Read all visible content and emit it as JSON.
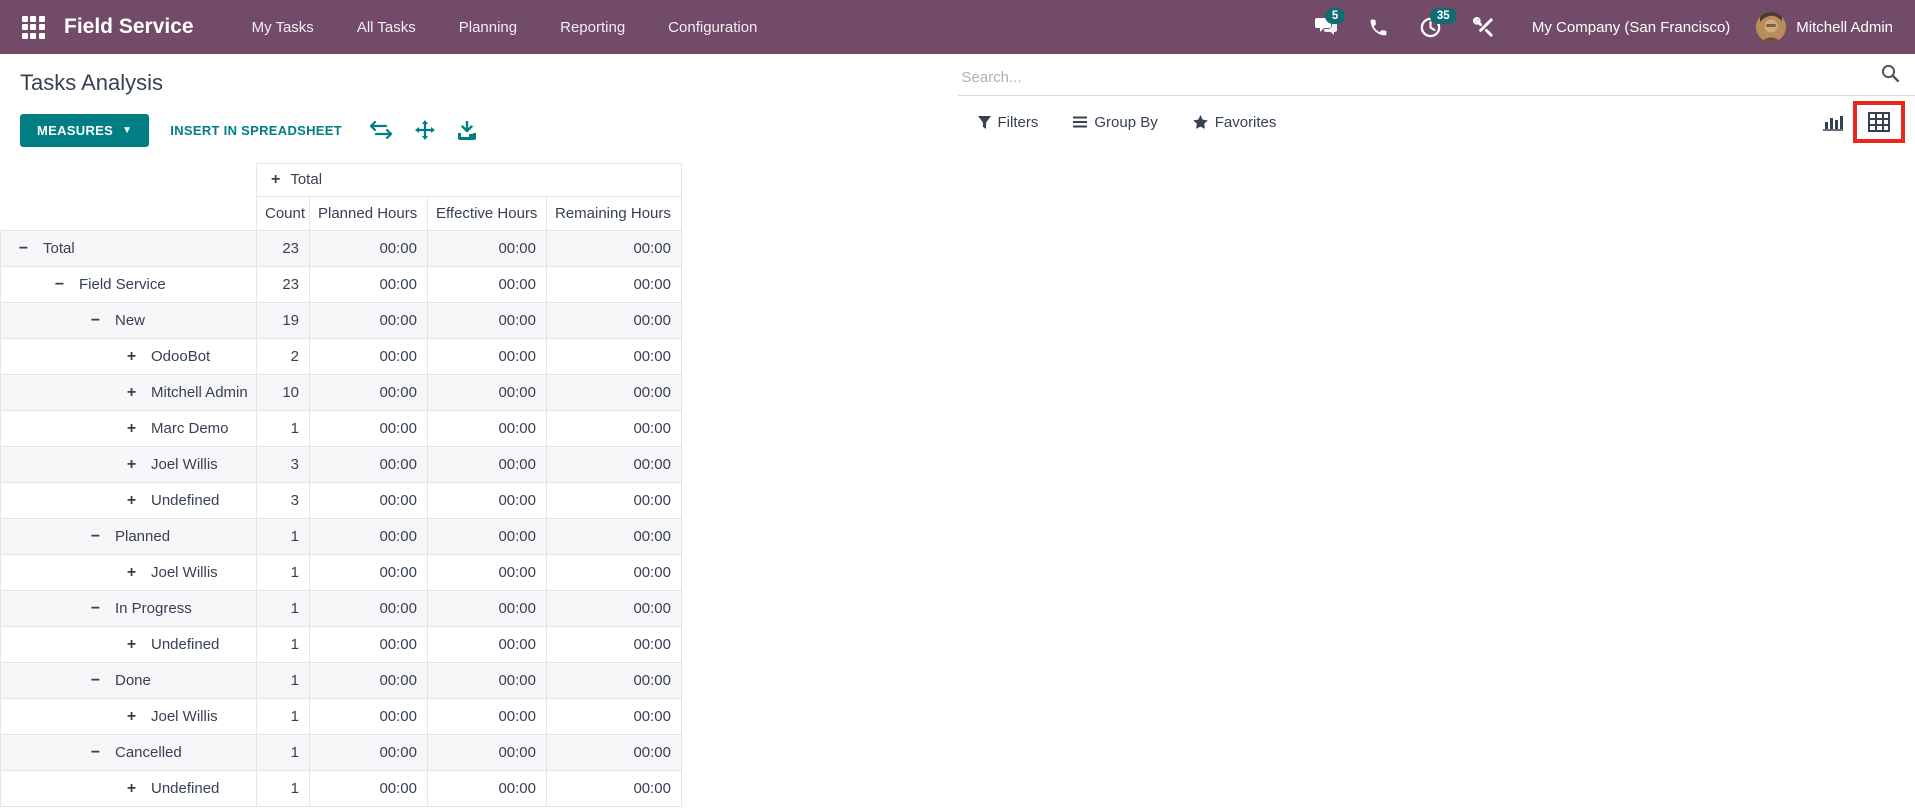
{
  "navbar": {
    "brand": "Field Service",
    "items": [
      "My Tasks",
      "All Tasks",
      "Planning",
      "Reporting",
      "Configuration"
    ],
    "systray": {
      "messages_badge": "5",
      "activities_badge": "35",
      "company": "My Company (San Francisco)",
      "user": "Mitchell Admin"
    }
  },
  "control_panel": {
    "title": "Tasks Analysis",
    "search_placeholder": "Search..."
  },
  "toolbar": {
    "measures_label": "MEASURES",
    "insert_label": "INSERT IN SPREADSHEET",
    "filters_label": "Filters",
    "group_by_label": "Group By",
    "favorites_label": "Favorites"
  },
  "colors": {
    "navbar_bg": "#714B67",
    "accent_teal": "#017E84",
    "badge_teal": "#0E6C72",
    "highlight_red": "#E8271F",
    "row_stripe": "#F7F7F9",
    "text_dark": "#374151"
  },
  "icons": {
    "apps": "grid-icon",
    "messages": "chat-bubbles-icon",
    "calls": "phone-icon",
    "activities": "clock-icon",
    "tools": "wrench-screwdriver-icon",
    "search": "magnifier-icon",
    "flip_axis": "swap-arrows-icon",
    "expand_all": "move-arrows-icon",
    "download": "download-icon",
    "filters": "funnel-icon",
    "group_by": "lines-icon",
    "favorites": "star-icon",
    "chart_view": "bar-chart-icon",
    "pivot_view": "pivot-grid-icon"
  },
  "table": {
    "corner_header": "Total",
    "column_headers": [
      "Count",
      "Planned Hours",
      "Effective Hours",
      "Remaining Hours"
    ],
    "rows": [
      {
        "label": "Total",
        "level": 0,
        "expanded": true,
        "values": [
          "23",
          "00:00",
          "00:00",
          "00:00"
        ]
      },
      {
        "label": "Field Service",
        "level": 1,
        "expanded": true,
        "values": [
          "23",
          "00:00",
          "00:00",
          "00:00"
        ]
      },
      {
        "label": "New",
        "level": 2,
        "expanded": true,
        "values": [
          "19",
          "00:00",
          "00:00",
          "00:00"
        ]
      },
      {
        "label": "OdooBot",
        "level": 3,
        "expanded": false,
        "values": [
          "2",
          "00:00",
          "00:00",
          "00:00"
        ]
      },
      {
        "label": "Mitchell Admin",
        "level": 3,
        "expanded": false,
        "values": [
          "10",
          "00:00",
          "00:00",
          "00:00"
        ]
      },
      {
        "label": "Marc Demo",
        "level": 3,
        "expanded": false,
        "values": [
          "1",
          "00:00",
          "00:00",
          "00:00"
        ]
      },
      {
        "label": "Joel Willis",
        "level": 3,
        "expanded": false,
        "values": [
          "3",
          "00:00",
          "00:00",
          "00:00"
        ]
      },
      {
        "label": "Undefined",
        "level": 3,
        "expanded": false,
        "values": [
          "3",
          "00:00",
          "00:00",
          "00:00"
        ]
      },
      {
        "label": "Planned",
        "level": 2,
        "expanded": true,
        "values": [
          "1",
          "00:00",
          "00:00",
          "00:00"
        ]
      },
      {
        "label": "Joel Willis",
        "level": 3,
        "expanded": false,
        "values": [
          "1",
          "00:00",
          "00:00",
          "00:00"
        ]
      },
      {
        "label": "In Progress",
        "level": 2,
        "expanded": true,
        "values": [
          "1",
          "00:00",
          "00:00",
          "00:00"
        ]
      },
      {
        "label": "Undefined",
        "level": 3,
        "expanded": false,
        "values": [
          "1",
          "00:00",
          "00:00",
          "00:00"
        ]
      },
      {
        "label": "Done",
        "level": 2,
        "expanded": true,
        "values": [
          "1",
          "00:00",
          "00:00",
          "00:00"
        ]
      },
      {
        "label": "Joel Willis",
        "level": 3,
        "expanded": false,
        "values": [
          "1",
          "00:00",
          "00:00",
          "00:00"
        ]
      },
      {
        "label": "Cancelled",
        "level": 2,
        "expanded": true,
        "values": [
          "1",
          "00:00",
          "00:00",
          "00:00"
        ]
      },
      {
        "label": "Undefined",
        "level": 3,
        "expanded": false,
        "values": [
          "1",
          "00:00",
          "00:00",
          "00:00"
        ]
      }
    ]
  }
}
